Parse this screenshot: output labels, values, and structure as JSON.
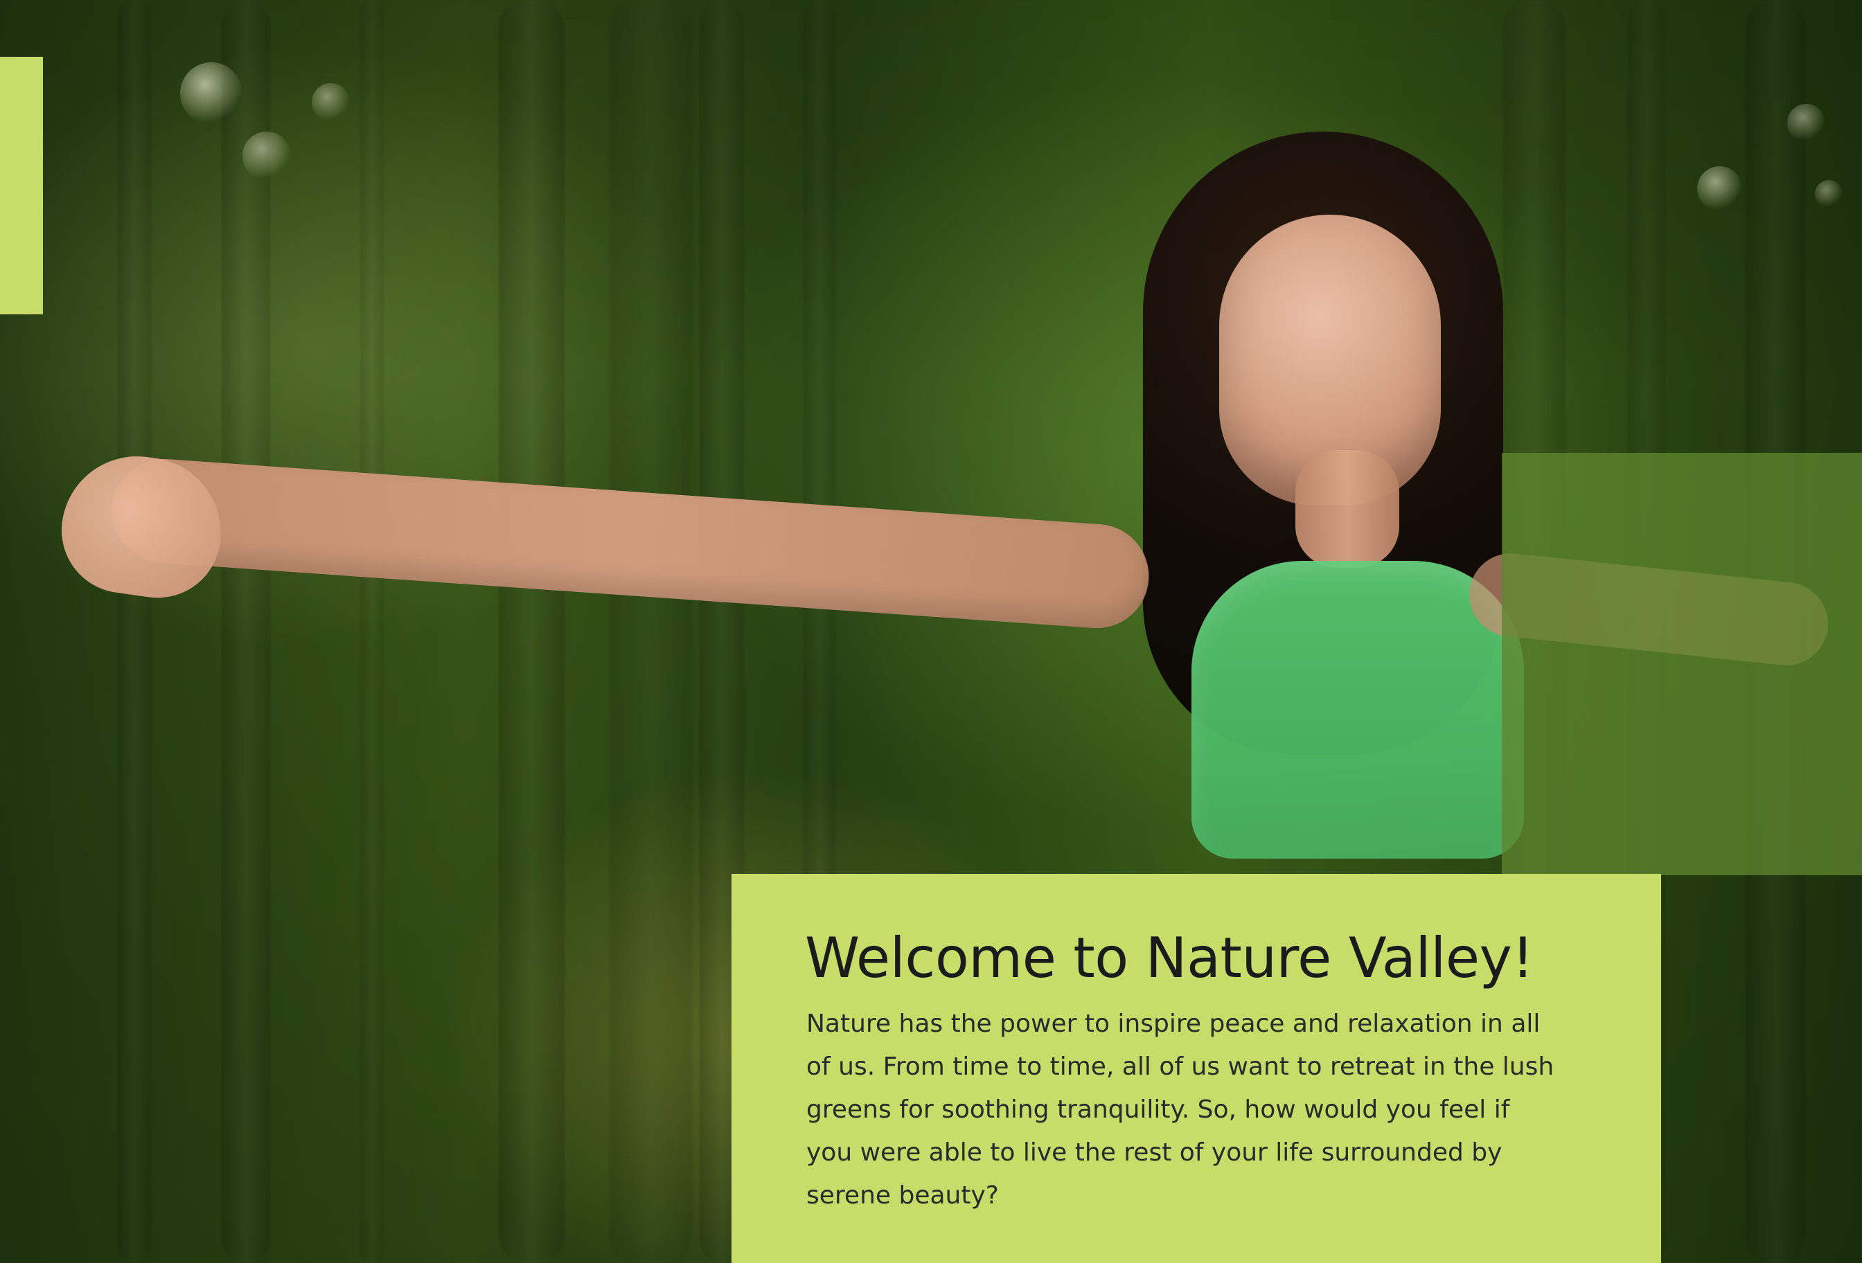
{
  "hero": {
    "title": "Welcome to Nature Valley!",
    "body": "Nature has the power to inspire peace and relaxation in all of us. From time to time, all of us want to retreat in the lush greens for soothing tranquility. So, how would you feel if you were able to live the rest of your life surrounded by serene beauty?"
  },
  "colors": {
    "card": "#c7dc69",
    "tint": "#5d852d"
  }
}
